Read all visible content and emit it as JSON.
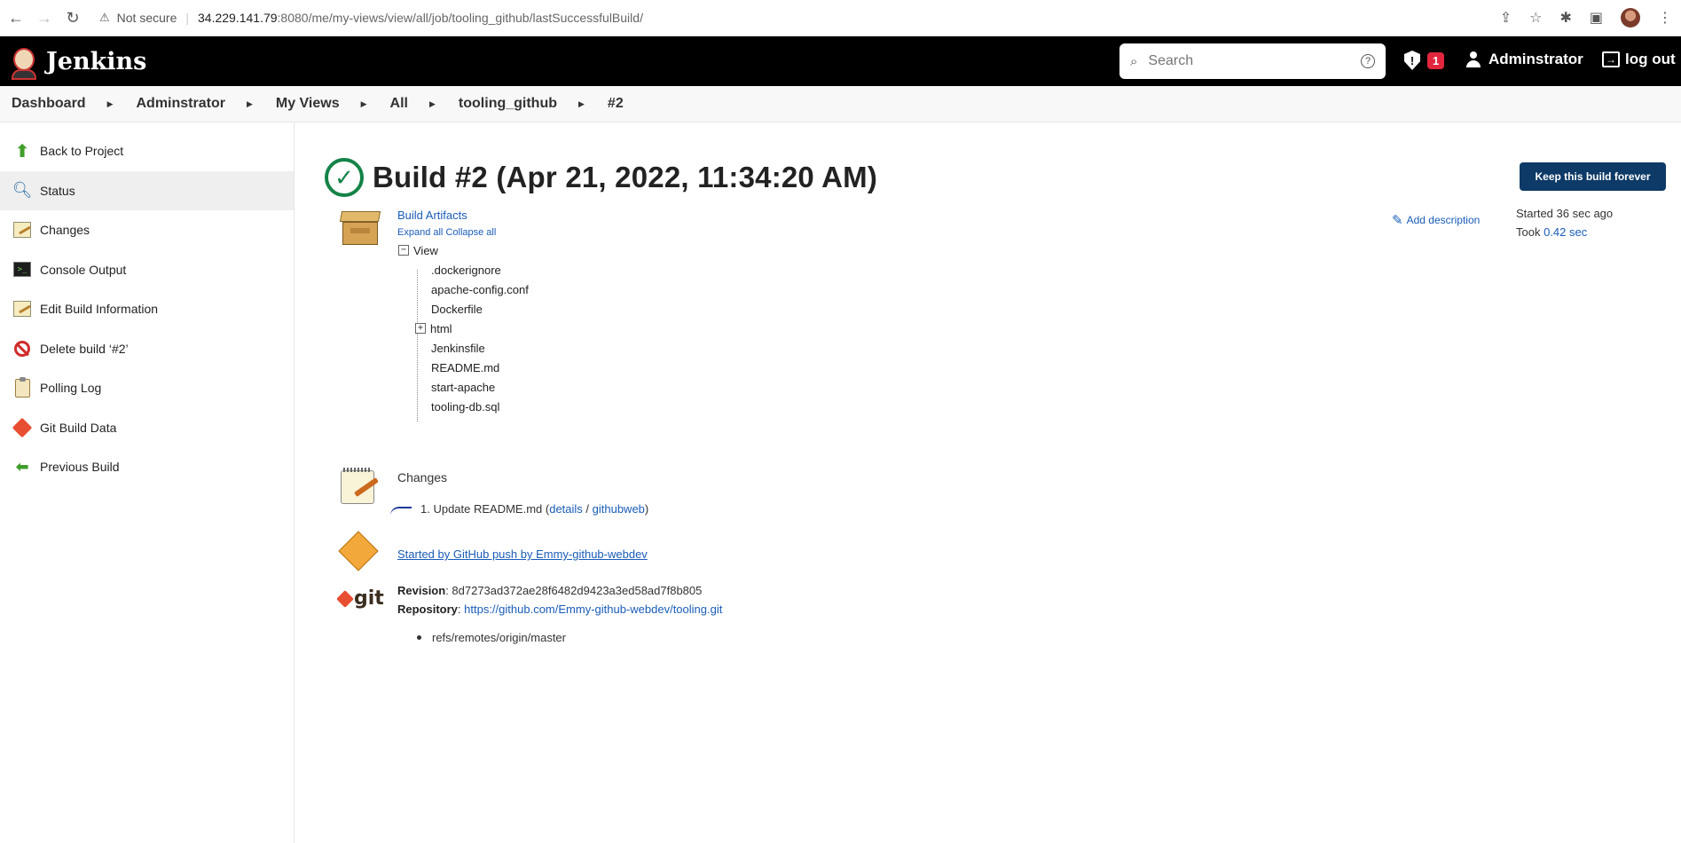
{
  "browser": {
    "not_secure": "Not secure",
    "url_host": "34.229.141.79",
    "url_path": ":8080/me/my-views/view/all/job/tooling_github/lastSuccessfulBuild/"
  },
  "header": {
    "app_name": "Jenkins",
    "search_placeholder": "Search",
    "alert_count": "1",
    "user_name": "Adminstrator",
    "logout_label": "log out"
  },
  "breadcrumb": [
    "Dashboard",
    "Adminstrator",
    "My Views",
    "All",
    "tooling_github",
    "#2"
  ],
  "sidebar": {
    "items": [
      {
        "label": "Back to Project",
        "icon": "up-arrow-icon"
      },
      {
        "label": "Status",
        "icon": "search-icon"
      },
      {
        "label": "Changes",
        "icon": "notepad-icon"
      },
      {
        "label": "Console Output",
        "icon": "terminal-icon"
      },
      {
        "label": "Edit Build Information",
        "icon": "notepad-icon"
      },
      {
        "label": "Delete build ‘#2’",
        "icon": "no-entry-icon"
      },
      {
        "label": "Polling Log",
        "icon": "clipboard-icon"
      },
      {
        "label": "Git Build Data",
        "icon": "git-icon"
      },
      {
        "label": "Previous Build",
        "icon": "left-arrow-icon"
      }
    ]
  },
  "build": {
    "title": "Build #2 (Apr 21, 2022, 11:34:20 AM)",
    "keep_forever_label": "Keep this build forever",
    "add_description_label": "Add description",
    "started_text": "Started 36 sec ago",
    "took_prefix": "Took ",
    "took_value": "0.42 sec"
  },
  "artifacts": {
    "title": "Build Artifacts",
    "expand_all": "Expand all",
    "collapse_all": "Collapse all",
    "root": "View",
    "root_toggle": "−",
    "folder_toggle": "+",
    "files": [
      ".dockerignore",
      "apache-config.conf",
      "Dockerfile",
      "html",
      "Jenkinsfile",
      "README.md",
      "start-apache",
      "tooling-db.sql"
    ]
  },
  "changes": {
    "heading": "Changes",
    "item_prefix": "1. Update README.md (",
    "details_label": "details",
    "slash": " / ",
    "githubweb_label": "githubweb",
    "item_suffix": ")"
  },
  "cause": {
    "text": "Started by GitHub push by Emmy-github-webdev"
  },
  "git": {
    "logo_text": "git",
    "revision_label": "Revision",
    "revision_value": ": 8d7273ad372ae28f6482d9423a3ed58ad7f8b805",
    "repository_label": "Repository",
    "repository_sep": ": ",
    "repository_url": "https://github.com/Emmy-github-webdev/tooling.git",
    "ref": "refs/remotes/origin/master"
  },
  "colors": {
    "header_bg": "#000000",
    "success": "#138347",
    "link": "#1a5cb8",
    "keep_button": "#0d3a66",
    "alert_badge": "#e2263e"
  }
}
